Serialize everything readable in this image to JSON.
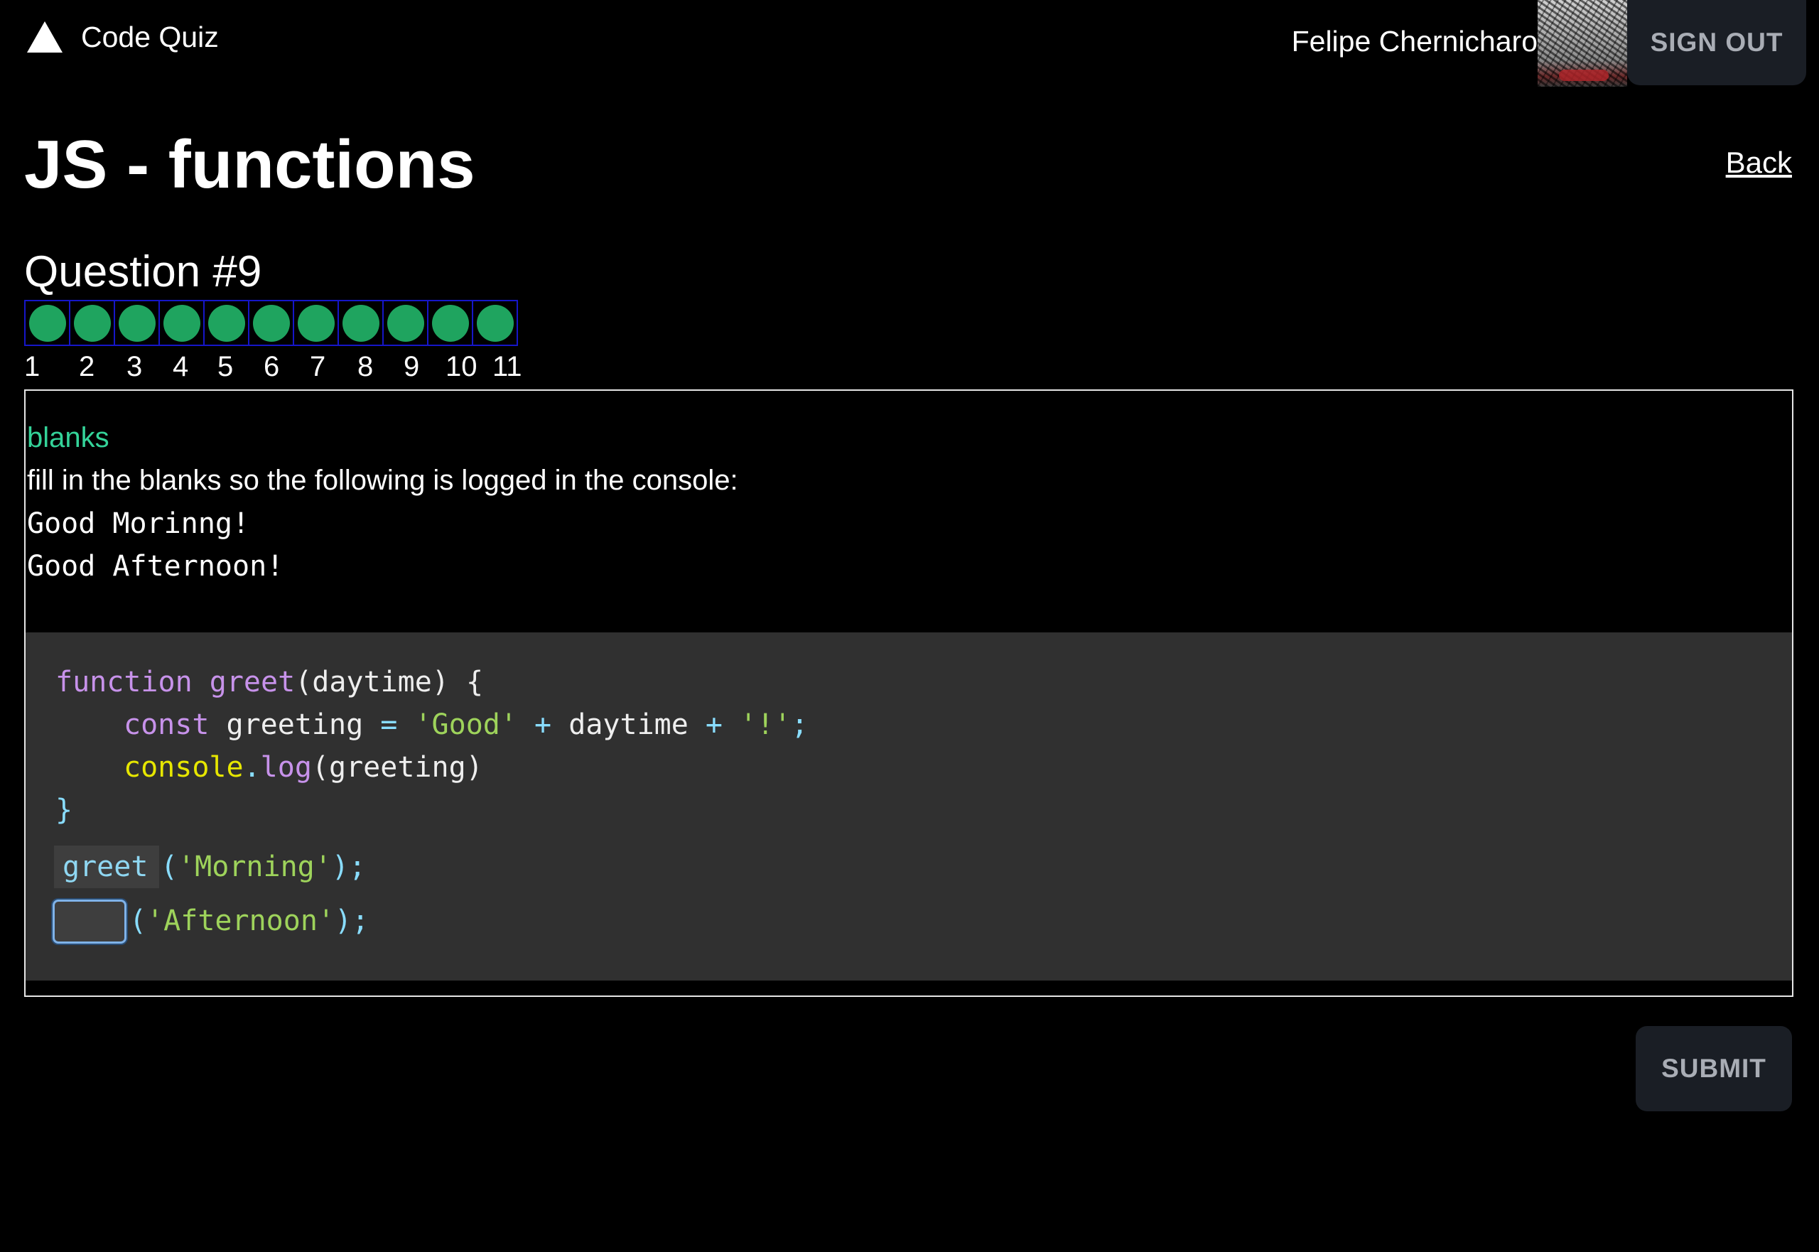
{
  "header": {
    "brand": "Code Quiz",
    "user_name": "Felipe Chernicharo",
    "signout_label": "SIGN OUT"
  },
  "page": {
    "title": "JS - functions",
    "back_label": "Back"
  },
  "question": {
    "heading": "Question #9",
    "progress": {
      "labels": [
        "1",
        "2",
        "3",
        "4",
        "5",
        "6",
        "7",
        "8",
        "9",
        "10",
        "11"
      ],
      "status_color": "#1fa45f"
    },
    "type": "blanks",
    "instruction": "fill in the blanks so the following is logged in the console:",
    "expected_output": [
      "Good Morinng!",
      "Good Afternoon!"
    ],
    "code": {
      "line1_kw": "function",
      "line1_fn": "greet",
      "line1_rest": "(daytime) {",
      "line2_kw": "const",
      "line2_var": "greeting",
      "line2_eq": "=",
      "line2_str1": "'Good'",
      "line2_plus1": "+",
      "line2_mid": "daytime",
      "line2_plus2": "+",
      "line2_str2": "'!'",
      "line2_end": ";",
      "line3_obj": "console",
      "line3_dot": ".",
      "line3_fn": "log",
      "line3_rest": "(greeting)",
      "line4": "}",
      "filled_blank": "greet",
      "call1_open": "(",
      "call1_arg": "'Morning'",
      "call1_close": ");",
      "call2_open": "(",
      "call2_arg": "'Afternoon'",
      "call2_close": ");",
      "blank_value": ""
    }
  },
  "actions": {
    "submit_label": "SUBMIT"
  }
}
